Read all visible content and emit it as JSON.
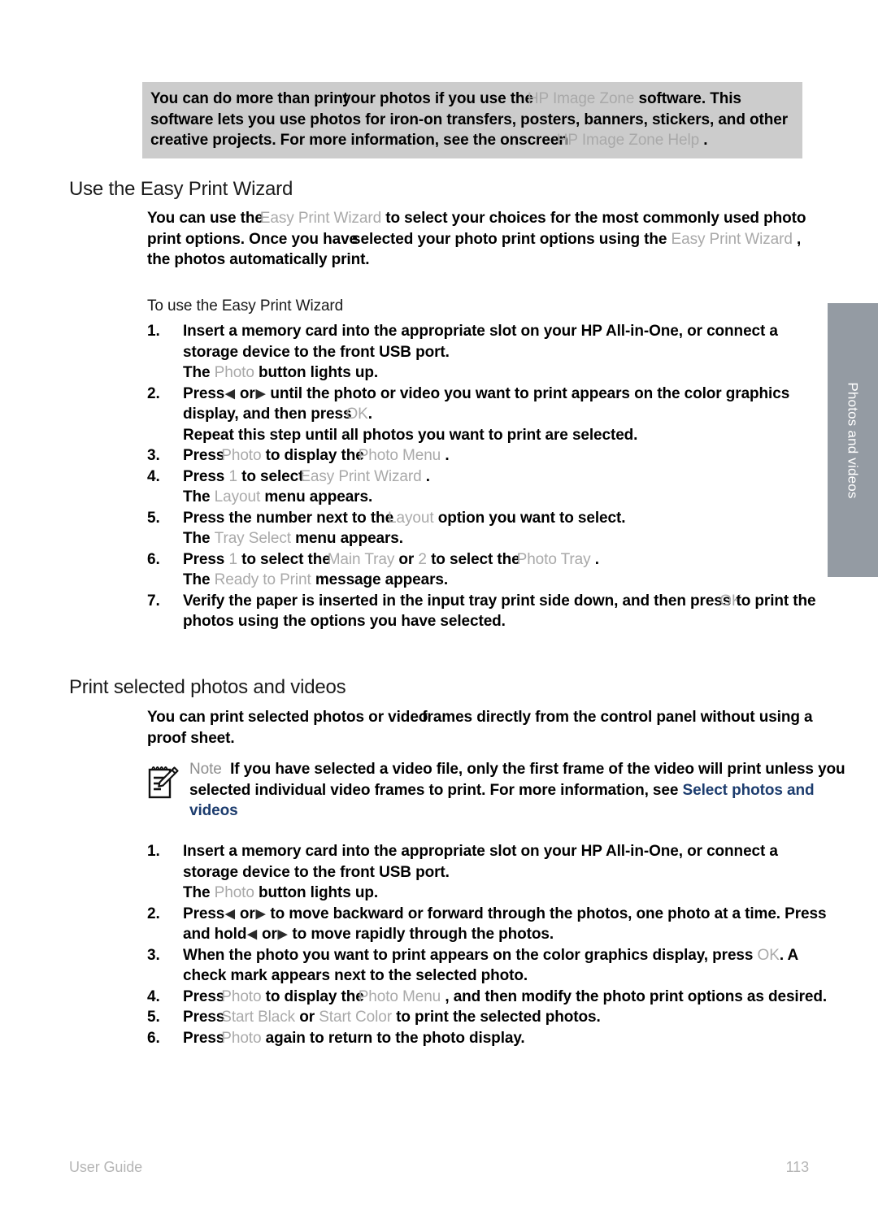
{
  "side_tab": {
    "label": "Photos and videos"
  },
  "callout": {
    "line1_a": "You can do more than print",
    "line1_b": "your photos if you use the",
    "line1_ui": "HP Image Zone",
    "line1_c": "software. This",
    "line2": "software lets you use photos for iron-on transfers, posters, banners, stickers, and",
    "line3_a": "other creative projects. For more information, see the onscreen",
    "line3_ui": "HP Image Zone Help",
    "line3_c": "."
  },
  "sections": [
    {
      "heading": "Use the Easy Print Wizard",
      "intro": {
        "a": "You can use the",
        "ui1": "Easy Print Wizard",
        "b": "to select your choices for the most commonly used photo print options. Once you have",
        "c": "selected your photo print options using the",
        "ui2": "Easy Print Wizard",
        "d": ", the photos automatically print."
      },
      "subheading": "To use the Easy Print Wizard",
      "steps": [
        {
          "num": "1.",
          "main": "Insert a memory card into the appropriate slot on your HP All-in-One, or connect a storage device to the front USB port.",
          "extra_a": "The",
          "extra_ui": "Photo",
          "extra_b": "button lights up."
        },
        {
          "num": "2.",
          "main_a": "Press",
          "arrow_left": "◀",
          "main_or": "or",
          "arrow_right": "▶",
          "main_b": "until the photo or video you want to print appears on the color graphics display, and then press",
          "main_ui": "OK",
          "main_c": ".",
          "extra": "Repeat this step until all photos you want to print are selected."
        },
        {
          "num": "3.",
          "a": "Press",
          "ui1": "Photo",
          "b": "to display the",
          "ui2": "Photo Menu",
          "c": "."
        },
        {
          "num": "4.",
          "a": "Press",
          "ui_num": "1",
          "b": "to select",
          "ui1": "Easy Print Wizard",
          "c": ".",
          "extra_a": "The",
          "extra_ui": "Layout",
          "extra_b": "menu appears."
        },
        {
          "num": "5.",
          "a": "Press the number next to the",
          "ui1": "Layout",
          "b": "option you want to select.",
          "extra_a": "The",
          "extra_ui": "Tray Select",
          "extra_b": "menu appears."
        },
        {
          "num": "6.",
          "a": "Press",
          "ui_num1": "1",
          "b": "to select the",
          "ui1": "Main Tray",
          "c": "or",
          "ui_num2": "2",
          "d": "to select the",
          "ui2": "Photo Tray",
          "e": ".",
          "extra_a": "The",
          "extra_ui": "Ready to Print",
          "extra_b": "message appears."
        },
        {
          "num": "7.",
          "a": "Verify the paper is inserted in the input tray print side down, and then press",
          "ui1": "OK",
          "b": "to print the photos using the options you have selected."
        }
      ]
    },
    {
      "heading": "Print selected photos and videos",
      "intro": {
        "a": "You can print selected photos or video",
        "b": "frames directly from the control panel without using a proof sheet."
      },
      "note": {
        "icon": "notepad-pencil-icon",
        "label": "Note",
        "text_a": "If you have selected a video file, only the first frame of the video will print unless you selected individual video frames to print. For more information, see",
        "link": "Select photos and videos"
      },
      "steps": [
        {
          "num": "1.",
          "main": "Insert a memory card into the appropriate slot on your HP All-in-One, or connect a storage device to the front USB port.",
          "extra_a": "The",
          "extra_ui": "Photo",
          "extra_b": "button lights up."
        },
        {
          "num": "2.",
          "a": "Press",
          "arrow_left": "◀",
          "or1": "or",
          "arrow_right": "▶",
          "b": "to move backward or forward through the photos, one photo at a time. Press and hold",
          "arrow_left2": "◀",
          "or2": "or",
          "arrow_right2": "▶",
          "c": "to move rapidly through the photos."
        },
        {
          "num": "3.",
          "a": "When the photo you want to print appears on the color graphics display, press",
          "ui1": "OK",
          "b": ". A check mark appears next to the selected photo."
        },
        {
          "num": "4.",
          "a": "Press",
          "ui1": "Photo",
          "b": "to display the",
          "ui2": "Photo Menu",
          "c": ", and then modify the photo print options as desired."
        },
        {
          "num": "5.",
          "a": "Press",
          "ui1": "Start Black",
          "b": "or",
          "ui2": "Start Color",
          "c": "to print the selected photos."
        },
        {
          "num": "6.",
          "a": "Press",
          "ui1": "Photo",
          "b": "again to return to the photo display."
        }
      ]
    }
  ],
  "footer": {
    "left": "User Guide",
    "page": "113"
  },
  "colors": {
    "callout_bg": "#cccccc",
    "side_tab_bg": "#949ba3",
    "ui_term": "#a9a9a9",
    "link": "#1c3c6e",
    "footer_text": "#b5b5b5"
  }
}
